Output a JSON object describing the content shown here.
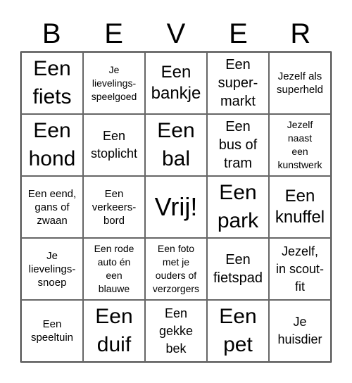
{
  "title_letters": [
    "B",
    "E",
    "V",
    "E",
    "R"
  ],
  "rows": [
    [
      {
        "text": "Een fiets",
        "lines": [
          "Een",
          "fiets"
        ],
        "size": "xl"
      },
      {
        "text": "Je lievelings-speelgoed",
        "lines": [
          "Je",
          "lievelings-",
          "speelgoed"
        ],
        "size": "xxs"
      },
      {
        "text": "Een bankje",
        "lines": [
          "Een",
          "bankje"
        ],
        "size": "lg"
      },
      {
        "text": "Een super-markt",
        "lines": [
          "Een",
          "super-",
          "markt"
        ],
        "size": "md"
      },
      {
        "text": "Jezelf als superheld",
        "lines": [
          "Jezelf als",
          "superheld"
        ],
        "size": "xs"
      }
    ],
    [
      {
        "text": "Een hond",
        "lines": [
          "Een",
          "hond"
        ],
        "size": "xl"
      },
      {
        "text": "Een stoplicht",
        "lines": [
          "Een",
          "stoplicht"
        ],
        "size": "sm"
      },
      {
        "text": "Een bal",
        "lines": [
          "Een",
          "bal"
        ],
        "size": "xl"
      },
      {
        "text": "Een bus of tram",
        "lines": [
          "Een",
          "bus of",
          "tram"
        ],
        "size": "md"
      },
      {
        "text": "Jezelf naast een kunstwerk",
        "lines": [
          "Jezelf",
          "naast",
          "een",
          "kunstwerk"
        ],
        "size": "xxs"
      }
    ],
    [
      {
        "text": "Een eend, gans of zwaan",
        "lines": [
          "Een eend,",
          "gans of",
          "zwaan"
        ],
        "size": "xs"
      },
      {
        "text": "Een verkeers-bord",
        "lines": [
          "Een",
          "verkeers-",
          "bord"
        ],
        "size": "xs"
      },
      {
        "text": "Vrij!",
        "lines": [
          "Vrij!"
        ],
        "size": "free"
      },
      {
        "text": "Een park",
        "lines": [
          "Een",
          "park"
        ],
        "size": "xl"
      },
      {
        "text": "Een knuffel",
        "lines": [
          "Een",
          "knuffel"
        ],
        "size": "lg"
      }
    ],
    [
      {
        "text": "Je lievelings-snoep",
        "lines": [
          "Je",
          "lievelings-",
          "snoep"
        ],
        "size": "xs"
      },
      {
        "text": "Een rode auto én een blauwe",
        "lines": [
          "Een rode",
          "auto én",
          "een",
          "blauwe"
        ],
        "size": "xxs"
      },
      {
        "text": "Een foto met je ouders of verzorgers",
        "lines": [
          "Een foto",
          "met je",
          "ouders of",
          "verzorgers"
        ],
        "size": "xxs"
      },
      {
        "text": "Een fietspad",
        "lines": [
          "Een",
          "fietspad"
        ],
        "size": "md"
      },
      {
        "text": "Jezelf, in scout-fit",
        "lines": [
          "Jezelf,",
          "in scout-",
          "fit"
        ],
        "size": "sm"
      }
    ],
    [
      {
        "text": "Een speeltuin",
        "lines": [
          "Een",
          "speeltuin"
        ],
        "size": "xs"
      },
      {
        "text": "Een duif",
        "lines": [
          "Een",
          "duif"
        ],
        "size": "xl"
      },
      {
        "text": "Een gekke bek",
        "lines": [
          "Een",
          "gekke",
          "bek"
        ],
        "size": "sm"
      },
      {
        "text": "Een pet",
        "lines": [
          "Een",
          "pet"
        ],
        "size": "xl"
      },
      {
        "text": "Je huisdier",
        "lines": [
          "Je",
          "huisdier"
        ],
        "size": "sm"
      }
    ]
  ]
}
